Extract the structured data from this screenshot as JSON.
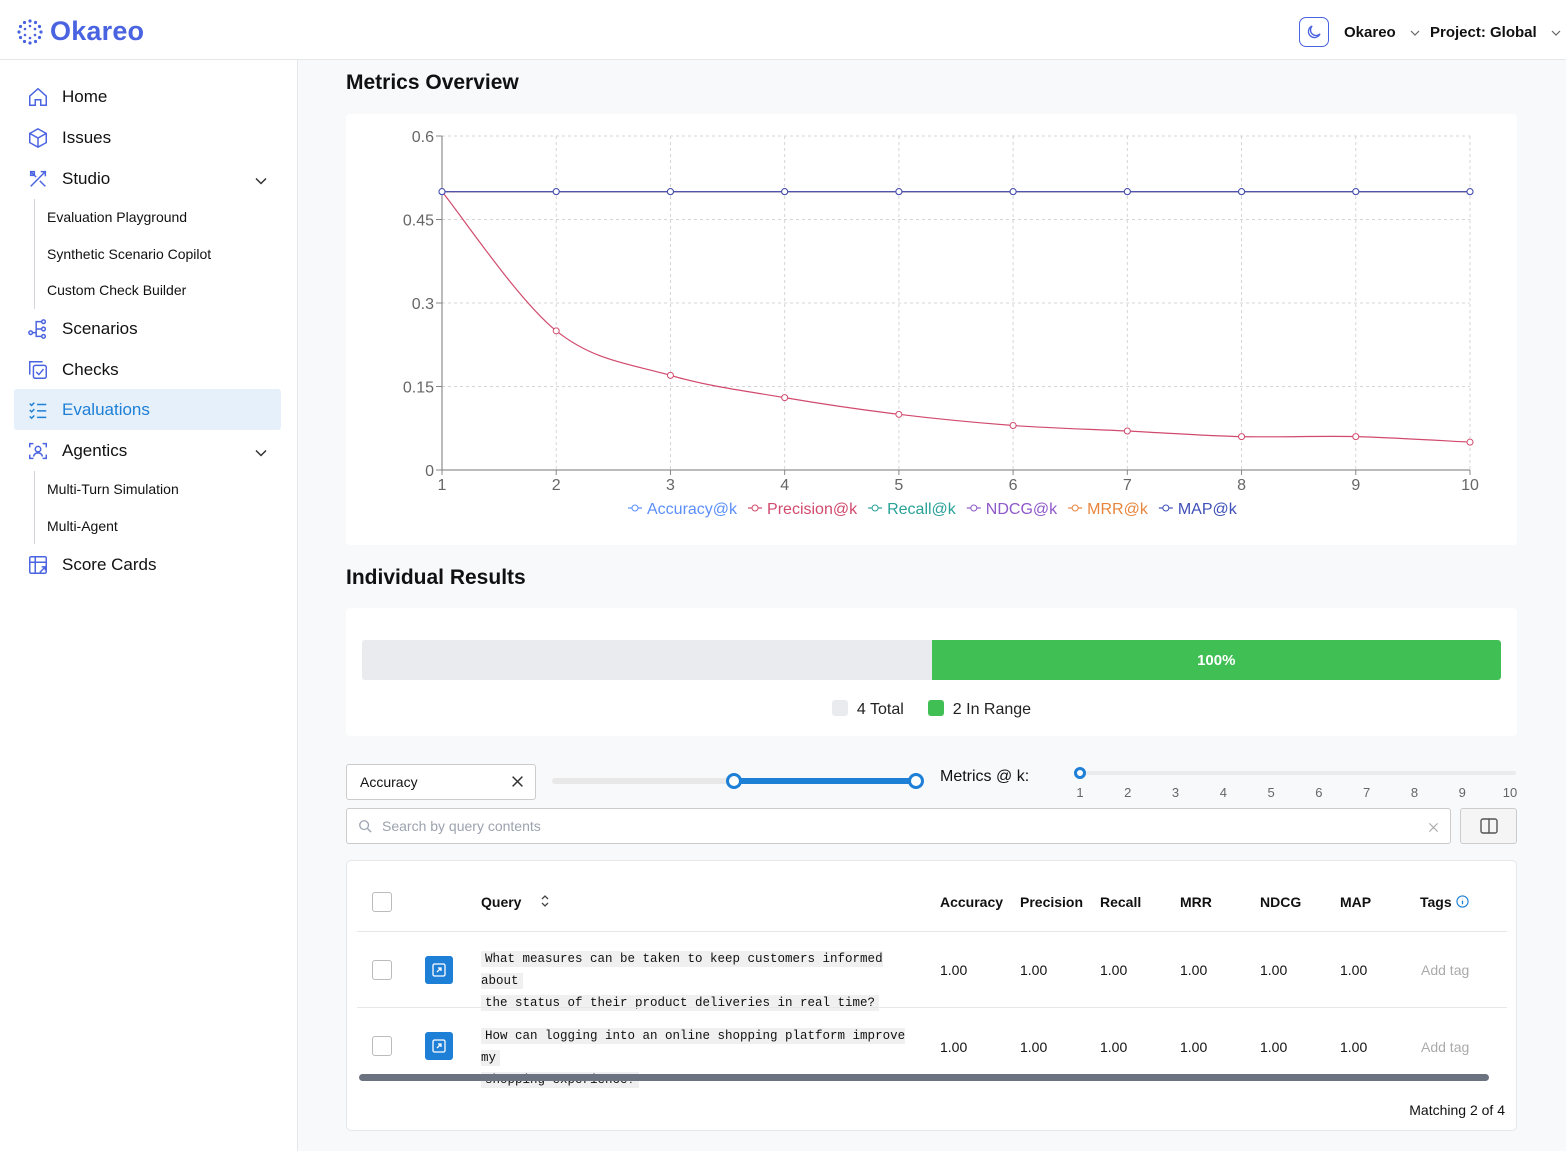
{
  "app": {
    "name": "Okareo"
  },
  "header": {
    "org": "Okareo",
    "project": "Project: Global",
    "theme_icon": "moon-icon"
  },
  "sidebar": {
    "home": "Home",
    "issues": "Issues",
    "studio": "Studio",
    "studio_children": [
      "Evaluation Playground",
      "Synthetic Scenario Copilot",
      "Custom Check Builder"
    ],
    "scenarios": "Scenarios",
    "checks": "Checks",
    "evaluations": "Evaluations",
    "agentics": "Agentics",
    "agentics_children": [
      "Multi-Turn Simulation",
      "Multi-Agent"
    ],
    "score_cards": "Score Cards"
  },
  "metrics_overview": {
    "title": "Metrics Overview"
  },
  "chart_data": {
    "type": "line",
    "x": [
      1,
      2,
      3,
      4,
      5,
      6,
      7,
      8,
      9,
      10
    ],
    "ylim": [
      0,
      0.6
    ],
    "yticks": [
      "0",
      "0.15",
      "0.3",
      "0.45",
      "0.6"
    ],
    "grid": true,
    "legend_position": "bottom",
    "series": [
      {
        "name": "Accuracy@k",
        "color": "#5b8ff9",
        "values": [
          0.5,
          0.5,
          0.5,
          0.5,
          0.5,
          0.5,
          0.5,
          0.5,
          0.5,
          0.5
        ]
      },
      {
        "name": "Precision@k",
        "color": "#d14a6d",
        "values": [
          0.5,
          0.25,
          0.17,
          0.13,
          0.1,
          0.08,
          0.07,
          0.06,
          0.06,
          0.05
        ]
      },
      {
        "name": "Recall@k",
        "color": "#2aa198",
        "values": [
          0.5,
          0.5,
          0.5,
          0.5,
          0.5,
          0.5,
          0.5,
          0.5,
          0.5,
          0.5
        ]
      },
      {
        "name": "NDCG@k",
        "color": "#8e59c9",
        "values": [
          0.5,
          0.5,
          0.5,
          0.5,
          0.5,
          0.5,
          0.5,
          0.5,
          0.5,
          0.5
        ]
      },
      {
        "name": "MRR@k",
        "color": "#e8853d",
        "values": [
          0.5,
          0.5,
          0.5,
          0.5,
          0.5,
          0.5,
          0.5,
          0.5,
          0.5,
          0.5
        ]
      },
      {
        "name": "MAP@k",
        "color": "#3e4fb8",
        "values": [
          0.5,
          0.5,
          0.5,
          0.5,
          0.5,
          0.5,
          0.5,
          0.5,
          0.5,
          0.5
        ]
      }
    ]
  },
  "individual_results": {
    "title": "Individual Results",
    "progress_fraction": 0.5,
    "progress_label": "100%",
    "legend_total": "4 Total",
    "legend_in_range": "2 In Range",
    "color_total": "#e9ebee",
    "color_in_range": "#40bf55"
  },
  "filters": {
    "metric": "Accuracy",
    "range_low_fraction": 0.5,
    "range_high_fraction": 1.0,
    "metrics_k_label": "Metrics @ k:",
    "k_values": [
      "1",
      "2",
      "3",
      "4",
      "5",
      "6",
      "7",
      "8",
      "9",
      "10"
    ],
    "k_selected": "1",
    "search_placeholder": "Search by query contents"
  },
  "table": {
    "headers": {
      "query": "Query",
      "accuracy": "Accuracy",
      "precision": "Precision",
      "recall": "Recall",
      "mrr": "MRR",
      "ndcg": "NDCG",
      "map": "MAP",
      "tags": "Tags"
    },
    "rows": [
      {
        "query_line1": "What measures can be taken to keep customers informed about",
        "query_line2": "the status of their product deliveries in real time?",
        "accuracy": "1.00",
        "precision": "1.00",
        "recall": "1.00",
        "mrr": "1.00",
        "ndcg": "1.00",
        "map": "1.00",
        "tag": "Add tag"
      },
      {
        "query_line1": "How can logging into an online shopping platform improve my",
        "query_line2": "shopping experience?",
        "accuracy": "1.00",
        "precision": "1.00",
        "recall": "1.00",
        "mrr": "1.00",
        "ndcg": "1.00",
        "map": "1.00",
        "tag": "Add tag"
      }
    ],
    "matching": "Matching 2 of 4"
  }
}
